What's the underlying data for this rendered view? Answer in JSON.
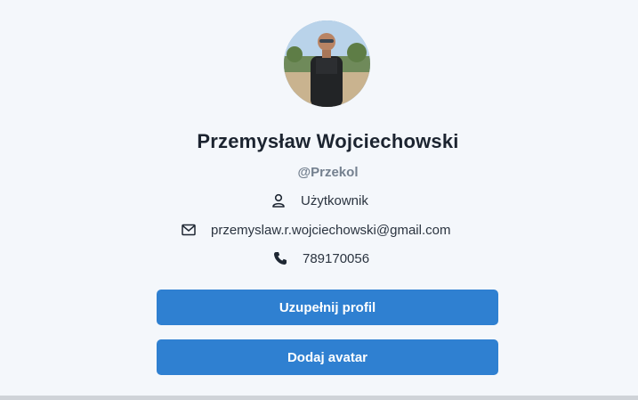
{
  "profile": {
    "full_name": "Przemysław Wojciechowski",
    "username": "@Przekol",
    "role": "Użytkownik",
    "email": "przemyslaw.r.wojciechowski@gmail.com",
    "phone": "789170056"
  },
  "icons": {
    "role": "user-icon",
    "email": "envelope-icon",
    "phone": "phone-icon"
  },
  "actions": {
    "complete_profile_label": "Uzupełnij profil",
    "add_avatar_label": "Dodaj avatar"
  },
  "colors": {
    "accent": "#2f80d1",
    "background": "#f4f7fb",
    "muted_text": "#74808f"
  }
}
